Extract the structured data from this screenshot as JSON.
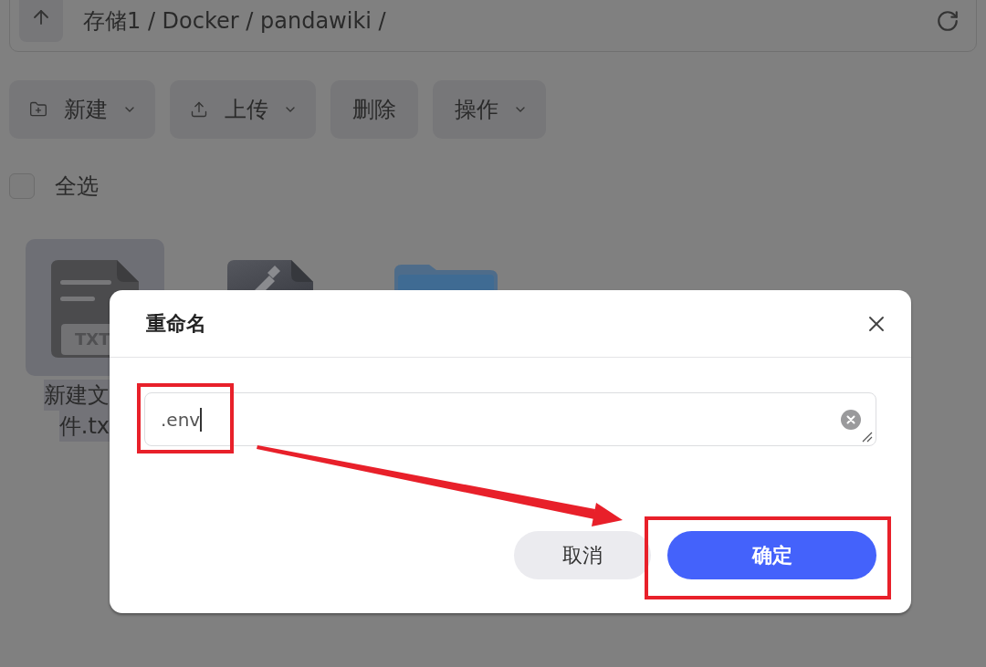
{
  "path_bar": {
    "path": "存储1 / Docker / pandawiki /"
  },
  "toolbar": [
    {
      "label": "新建",
      "kind": "create"
    },
    {
      "label": "上传",
      "kind": "upload"
    },
    {
      "label": "删除",
      "kind": "plain"
    },
    {
      "label": "操作",
      "kind": "menu"
    }
  ],
  "select_all": {
    "label": "全选",
    "checked": false
  },
  "files": [
    {
      "kind": "text",
      "badge": "TXT",
      "name_lines": [
        "新建文",
        "件.tx"
      ],
      "selected": true
    },
    {
      "kind": "document",
      "selected": false
    },
    {
      "kind": "folder",
      "selected": false
    }
  ],
  "dialog": {
    "title": "重命名",
    "input": {
      "value": ".env"
    },
    "buttons": [
      {
        "label": "取消",
        "kind": "secondary"
      },
      {
        "label": "确定",
        "kind": "primary"
      }
    ]
  }
}
